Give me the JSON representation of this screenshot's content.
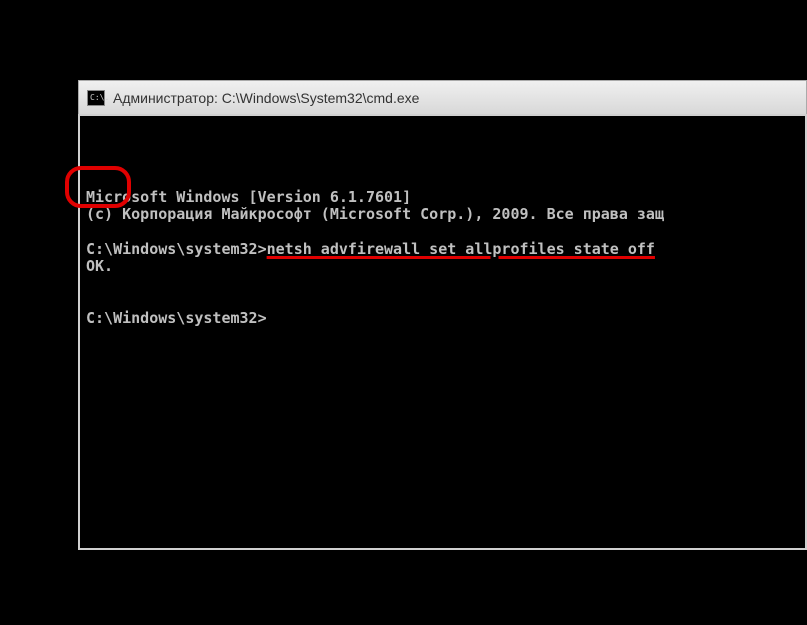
{
  "window": {
    "title": "Администратор: C:\\Windows\\System32\\cmd.exe",
    "icon_label": "C:\\."
  },
  "console": {
    "line1": "Microsoft Windows [Version 6.1.7601]",
    "line2": "(с) Корпорация Майкрософт (Microsoft Corp.), 2009. Все права защ",
    "prompt1_prefix": "C:\\Windows\\system32>",
    "command": "netsh advfirewall set allprofiles state off",
    "ok": "ОК.",
    "prompt2": "C:\\Windows\\system32>"
  }
}
